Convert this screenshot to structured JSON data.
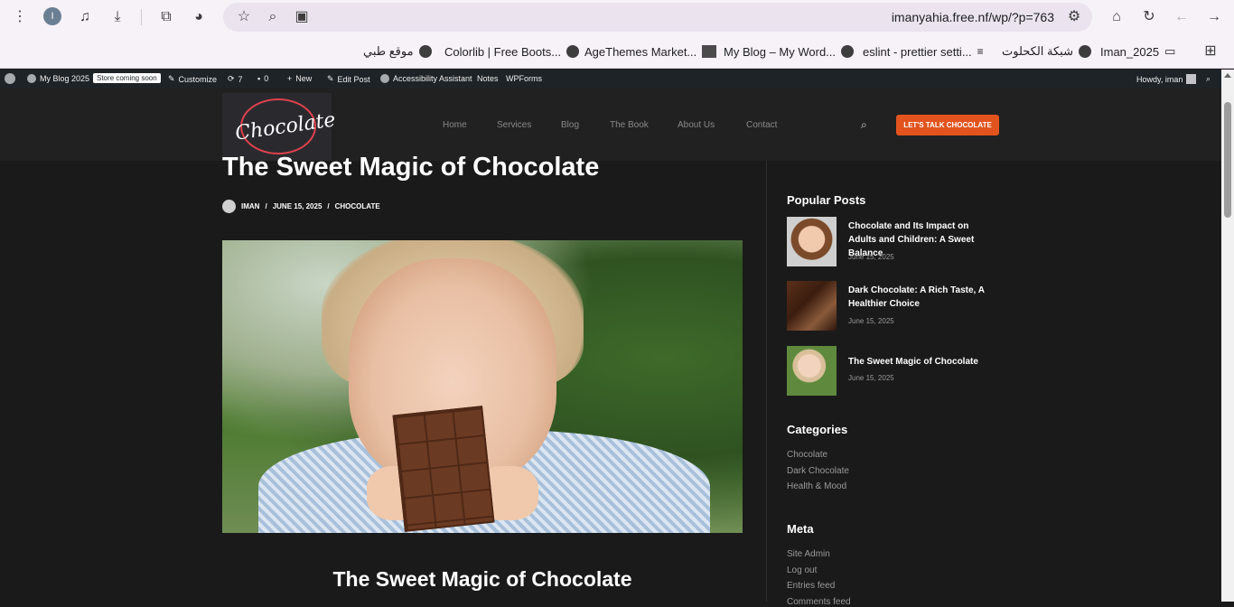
{
  "browser": {
    "url": "imanyahia.free.nf/wp/?p=763",
    "profile_initial": "I"
  },
  "bookmarks": [
    {
      "label": "موقع طبي"
    },
    {
      "label": "Colorlib | Free Boots..."
    },
    {
      "label": "AgeThemes Market..."
    },
    {
      "label": "My Blog – My Word..."
    },
    {
      "label": "eslint - prettier setti..."
    },
    {
      "label": "شبكة الكحلوت"
    },
    {
      "label": "Iman_2025"
    }
  ],
  "adminbar": {
    "site_name": "My Blog 2025",
    "coming_soon": "Store coming soon",
    "customize": "Customize",
    "updates": "7",
    "comments": "0",
    "new": "New",
    "edit_post": "Edit Post",
    "accessibility": "Accessibility Assistant",
    "notes": "Notes",
    "wpforms": "WPForms",
    "howdy": "Howdy, iman"
  },
  "header": {
    "logo_text": "Chocolate",
    "nav": [
      "Home",
      "Services",
      "Blog",
      "The Book",
      "About Us",
      "Contact"
    ],
    "cta": "LET'S TALK CHOCOLATE"
  },
  "post": {
    "title": "The Sweet Magic of Chocolate",
    "author": "IMAN",
    "date": "JUNE 15, 2025",
    "category": "CHOCOLATE",
    "heading": "The Sweet Magic of Chocolate"
  },
  "sidebar": {
    "popular_title": "Popular Posts",
    "popular": [
      {
        "title": "Chocolate and Its Impact on Adults and Children: A Sweet Balance",
        "date": "June 15, 2025"
      },
      {
        "title": "Dark Chocolate: A Rich Taste, A Healthier Choice",
        "date": "June 15, 2025"
      },
      {
        "title": "The Sweet Magic of Chocolate",
        "date": "June 15, 2025"
      }
    ],
    "categories_title": "Categories",
    "categories": [
      "Chocolate",
      "Dark Chocolate",
      "Health & Mood"
    ],
    "meta_title": "Meta",
    "meta": [
      "Site Admin",
      "Log out",
      "Entries feed",
      "Comments feed"
    ]
  },
  "colors": {
    "accent": "#e2531e",
    "header_bg": "#212121",
    "page_bg": "#1a1a1a",
    "adminbar_bg": "#1d2327"
  }
}
